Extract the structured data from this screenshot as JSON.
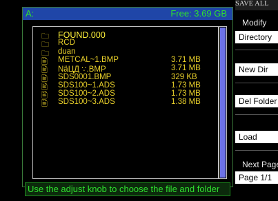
{
  "title": {
    "drive": "A:",
    "free": "Free: 3.69 GB"
  },
  "files": [
    {
      "icon": "folder-icon",
      "glyph": "🗀",
      "name": "FOUND.000",
      "size": "",
      "selected": true
    },
    {
      "icon": "folder-icon",
      "glyph": "🗀",
      "name": "RCD",
      "size": ""
    },
    {
      "icon": "folder-icon",
      "glyph": "🗀",
      "name": "duan",
      "size": ""
    },
    {
      "icon": "file-icon",
      "glyph": "🖹",
      "name": "METCAL~1.BMP",
      "size": "3.71 MB"
    },
    {
      "icon": "file-icon",
      "glyph": "🖹",
      "name": "NäЦД ∵.BMP",
      "size": "3.71 MB"
    },
    {
      "icon": "file-icon",
      "glyph": "🖹",
      "name": "SDS0001.BMP",
      "size": "329 KB"
    },
    {
      "icon": "file-icon",
      "glyph": "🖹",
      "name": "SDS100~1.ADS",
      "size": "1.73 MB"
    },
    {
      "icon": "file-icon",
      "glyph": "🖹",
      "name": "SDS100~2.ADS",
      "size": "1.73 MB"
    },
    {
      "icon": "file-icon",
      "glyph": "🖹",
      "name": "SDS100~3.ADS",
      "size": "1.38 MB"
    }
  ],
  "status": "Use the adjust knob to choose the file and folder",
  "menu": {
    "header": "SAVE ALL",
    "modify_label": "Modify",
    "modify_value": "Directory",
    "new_dir": "New Dir",
    "del_folder": "Del Folder",
    "load": "Load",
    "next_page_label": "Next Page",
    "page_value": "Page 1/1"
  },
  "colors": {
    "title_bg": "#1f46a8",
    "text_green": "#2fe02f",
    "file_yellow": "#e8cf2a",
    "scroll_thumb": "#6d72e8"
  }
}
